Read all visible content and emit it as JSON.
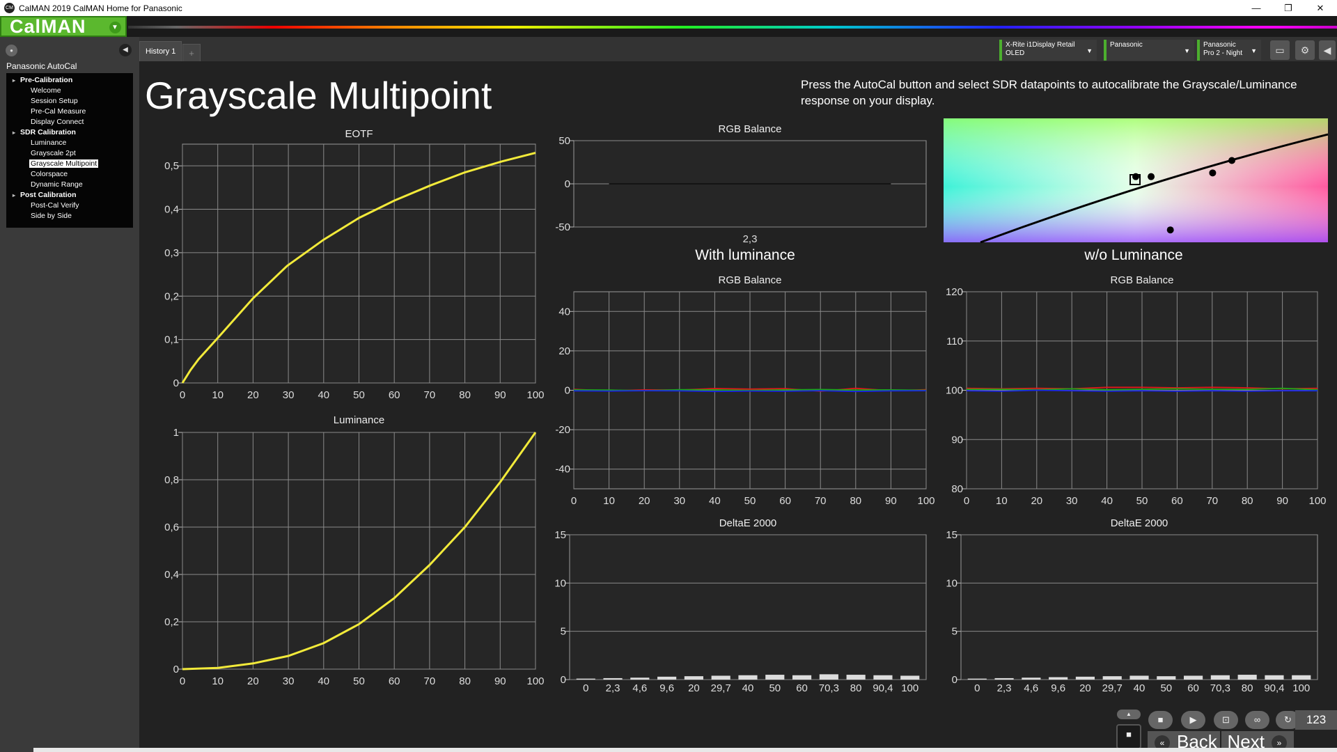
{
  "window": {
    "title": "CalMAN 2019 CalMAN Home for Panasonic",
    "icon_label": "CM"
  },
  "toolbar": {
    "logo": "CalMAN"
  },
  "sidebar": {
    "title": "Panasonic AutoCal",
    "tree": [
      {
        "type": "group",
        "label": "Pre-Calibration"
      },
      {
        "type": "item",
        "label": "Welcome"
      },
      {
        "type": "item",
        "label": "Session Setup"
      },
      {
        "type": "item",
        "label": "Pre-Cal Measure"
      },
      {
        "type": "item",
        "label": "Display  Connect"
      },
      {
        "type": "group",
        "label": "SDR Calibration"
      },
      {
        "type": "item",
        "label": "Luminance"
      },
      {
        "type": "item",
        "label": "Grayscale 2pt"
      },
      {
        "type": "item",
        "label": "Grayscale Multipoint",
        "selected": true
      },
      {
        "type": "item",
        "label": "Colorspace"
      },
      {
        "type": "item",
        "label": "Dynamic Range"
      },
      {
        "type": "group",
        "label": "Post Calibration"
      },
      {
        "type": "item",
        "label": "Post-Cal Verify"
      },
      {
        "type": "item",
        "label": "Side by Side"
      }
    ]
  },
  "tabs": [
    {
      "label": "History 1"
    }
  ],
  "tab_add": "+",
  "devices": {
    "meter": {
      "line1": "X-Rite i1Display Retail",
      "line2": "OLED"
    },
    "display": {
      "line1": "Panasonic",
      "line2": ""
    },
    "mode": {
      "line1": "Panasonic",
      "line2": "Pro 2 - Night"
    }
  },
  "page": {
    "title": "Grayscale Multipoint",
    "instructions": "Press the AutoCal button and select SDR datapoints to autocalibrate the Grayscale/Luminance response on your display.",
    "section_with": "With luminance",
    "section_without": "w/o Luminance"
  },
  "colors": {
    "eotf": "#f2ea3a",
    "red": "#e01919",
    "green": "#19a819",
    "blue": "#1a24e6",
    "accent": "#4caf2e"
  },
  "chart_data": [
    {
      "id": "eotf",
      "type": "line",
      "title": "EOTF",
      "xlabel": "",
      "ylabel": "",
      "xlim": [
        0,
        100
      ],
      "ylim": [
        0,
        0.55
      ],
      "xticks": [
        0,
        10,
        20,
        30,
        40,
        50,
        60,
        70,
        80,
        90,
        100
      ],
      "yticks": [
        {
          "v": 0,
          "t": "0"
        },
        {
          "v": 0.1,
          "t": "0,1"
        },
        {
          "v": 0.2,
          "t": "0,2"
        },
        {
          "v": 0.3,
          "t": "0,3"
        },
        {
          "v": 0.4,
          "t": "0,4"
        },
        {
          "v": 0.5,
          "t": "0,5"
        }
      ],
      "series": [
        {
          "x": [
            0,
            2.3,
            4.6,
            9.6,
            20,
            29.7,
            40,
            50,
            60,
            70.3,
            80,
            90.4,
            100
          ],
          "y": [
            0,
            0.03,
            0.055,
            0.1,
            0.195,
            0.27,
            0.33,
            0.38,
            0.42,
            0.455,
            0.485,
            0.51,
            0.53
          ],
          "color": "#f2ea3a"
        }
      ]
    },
    {
      "id": "luminance",
      "type": "line",
      "title": "Luminance",
      "xlabel": "",
      "ylabel": "",
      "xlim": [
        0,
        100
      ],
      "ylim": [
        0,
        1
      ],
      "xticks": [
        0,
        10,
        20,
        30,
        40,
        50,
        60,
        70,
        80,
        90,
        100
      ],
      "yticks": [
        {
          "v": 0,
          "t": "0"
        },
        {
          "v": 0.2,
          "t": "0,2"
        },
        {
          "v": 0.4,
          "t": "0,4"
        },
        {
          "v": 0.6,
          "t": "0,6"
        },
        {
          "v": 0.8,
          "t": "0,8"
        },
        {
          "v": 1,
          "t": "1"
        }
      ],
      "series": [
        {
          "x": [
            0,
            10,
            20,
            30,
            40,
            50,
            60,
            70,
            80,
            90,
            100
          ],
          "y": [
            0,
            0.005,
            0.024,
            0.056,
            0.11,
            0.19,
            0.3,
            0.44,
            0.6,
            0.79,
            1.0
          ],
          "color": "#f2ea3a"
        }
      ]
    },
    {
      "id": "rgb-top",
      "type": "line",
      "title": "RGB Balance",
      "xlabel": "",
      "ylabel": "",
      "xlim": [
        0,
        1
      ],
      "ylim": [
        -50,
        50
      ],
      "xticks": [],
      "categories": [
        "2,3"
      ],
      "yticks": [
        {
          "v": -50,
          "t": "-50"
        },
        {
          "v": 0,
          "t": "0"
        },
        {
          "v": 50,
          "t": "50"
        }
      ],
      "series": [
        {
          "x": [
            0.1,
            0.9
          ],
          "y": [
            0,
            0
          ],
          "color": "#111"
        }
      ]
    },
    {
      "id": "rgb-with",
      "type": "line",
      "title": "RGB Balance",
      "xlabel": "",
      "ylabel": "",
      "xlim": [
        0,
        100
      ],
      "ylim": [
        -50,
        50
      ],
      "xticks": [
        0,
        10,
        20,
        30,
        40,
        50,
        60,
        70,
        80,
        90,
        100
      ],
      "yticks": [
        {
          "v": -40,
          "t": "-40"
        },
        {
          "v": -20,
          "t": "-20"
        },
        {
          "v": 0,
          "t": "0"
        },
        {
          "v": 20,
          "t": "20"
        },
        {
          "v": 40,
          "t": "40"
        }
      ],
      "series": [
        {
          "x": [
            0,
            10,
            20,
            30,
            40,
            50,
            60,
            70,
            80,
            90,
            100
          ],
          "y": [
            0.5,
            -0.3,
            0.2,
            0.1,
            0.9,
            0.6,
            0.8,
            -0.5,
            1.0,
            -0.2,
            0.3
          ],
          "color": "#e01919"
        },
        {
          "x": [
            0,
            10,
            20,
            30,
            40,
            50,
            60,
            70,
            80,
            90,
            100
          ],
          "y": [
            0.2,
            0.1,
            -0.2,
            0.3,
            0.2,
            -0.1,
            0.2,
            0.4,
            0.1,
            0.2,
            0
          ],
          "color": "#19a819"
        },
        {
          "x": [
            0,
            10,
            20,
            30,
            40,
            50,
            60,
            70,
            80,
            90,
            100
          ],
          "y": [
            -0.3,
            -0.4,
            -0.2,
            -0.3,
            -0.6,
            -0.4,
            -0.5,
            -0.2,
            -0.6,
            -0.3,
            -0.2
          ],
          "color": "#1a24e6"
        }
      ]
    },
    {
      "id": "rgb-without",
      "type": "line",
      "title": "RGB Balance",
      "xlabel": "",
      "ylabel": "",
      "xlim": [
        0,
        100
      ],
      "ylim": [
        80,
        120
      ],
      "xticks": [
        0,
        10,
        20,
        30,
        40,
        50,
        60,
        70,
        80,
        90,
        100
      ],
      "yticks": [
        {
          "v": 80,
          "t": "80"
        },
        {
          "v": 90,
          "t": "90"
        },
        {
          "v": 100,
          "t": "100"
        },
        {
          "v": 110,
          "t": "110"
        },
        {
          "v": 120,
          "t": "120"
        }
      ],
      "series": [
        {
          "x": [
            0,
            10,
            20,
            30,
            40,
            50,
            60,
            70,
            80,
            90,
            100
          ],
          "y": [
            100.4,
            100.3,
            100.4,
            100.3,
            100.6,
            100.6,
            100.5,
            100.6,
            100.5,
            100.3,
            100.4
          ],
          "color": "#e01919"
        },
        {
          "x": [
            0,
            10,
            20,
            30,
            40,
            50,
            60,
            70,
            80,
            90,
            100
          ],
          "y": [
            100.2,
            100.2,
            100.1,
            100.3,
            100.1,
            100.2,
            100.3,
            100.2,
            100.2,
            100.4,
            100.1
          ],
          "color": "#19a819"
        },
        {
          "x": [
            0,
            10,
            20,
            30,
            40,
            50,
            60,
            70,
            80,
            90,
            100
          ],
          "y": [
            99.9,
            99.8,
            100.0,
            99.9,
            99.8,
            99.9,
            99.8,
            99.9,
            99.8,
            99.9,
            99.9
          ],
          "color": "#1a24e6"
        }
      ]
    },
    {
      "id": "de-with",
      "type": "bar",
      "title": "DeltaE 2000",
      "xlabel": "",
      "ylabel": "",
      "ylim": [
        0,
        15
      ],
      "categories": [
        "0",
        "2,3",
        "4,6",
        "9,6",
        "20",
        "29,7",
        "40",
        "50",
        "60",
        "70,3",
        "80",
        "90,4",
        "100"
      ],
      "values": [
        0.1,
        0.15,
        0.2,
        0.3,
        0.35,
        0.4,
        0.45,
        0.5,
        0.45,
        0.55,
        0.5,
        0.45,
        0.4
      ],
      "yticks": [
        {
          "v": 0,
          "t": "0"
        },
        {
          "v": 5,
          "t": "5"
        },
        {
          "v": 10,
          "t": "10"
        },
        {
          "v": 15,
          "t": "15"
        }
      ]
    },
    {
      "id": "de-without",
      "type": "bar",
      "title": "DeltaE 2000",
      "xlabel": "",
      "ylabel": "",
      "ylim": [
        0,
        15
      ],
      "categories": [
        "0",
        "2,3",
        "4,6",
        "9,6",
        "20",
        "29,7",
        "40",
        "50",
        "60",
        "70,3",
        "80",
        "90,4",
        "100"
      ],
      "values": [
        0.1,
        0.15,
        0.2,
        0.25,
        0.3,
        0.35,
        0.4,
        0.35,
        0.4,
        0.45,
        0.5,
        0.45,
        0.45
      ],
      "yticks": [
        {
          "v": 0,
          "t": "0"
        },
        {
          "v": 5,
          "t": "5"
        },
        {
          "v": 10,
          "t": "10"
        },
        {
          "v": 15,
          "t": "15"
        }
      ]
    }
  ],
  "cie_points": [
    {
      "u": 0.54,
      "v": 0.47
    },
    {
      "u": 0.5,
      "v": 0.47
    },
    {
      "u": 0.7,
      "v": 0.44
    },
    {
      "u": 0.75,
      "v": 0.34
    },
    {
      "u": 0.59,
      "v": 0.9
    }
  ],
  "swatches": [
    {
      "label": "0",
      "gray": "#000000"
    },
    {
      "label": "2,3",
      "gray": "#060606",
      "active": true
    },
    {
      "label": "4,6",
      "gray": "#0c0c0c"
    },
    {
      "label": "9,6",
      "gray": "#181818"
    },
    {
      "label": "20",
      "gray": "#333333"
    },
    {
      "label": "29,7",
      "gray": "#4c4c4c"
    },
    {
      "label": "40",
      "gray": "#666666"
    },
    {
      "label": "50",
      "gray": "#808080"
    },
    {
      "label": "60",
      "gray": "#999999"
    },
    {
      "label": "70,3",
      "gray": "#b3b3b3"
    },
    {
      "label": "80",
      "gray": "#cccccc"
    },
    {
      "label": "90,4",
      "gray": "#e6e6e6"
    },
    {
      "label": "100",
      "gray": "#ffffff"
    }
  ],
  "nav": {
    "back": "Back",
    "next": "Next",
    "counter": "123"
  }
}
